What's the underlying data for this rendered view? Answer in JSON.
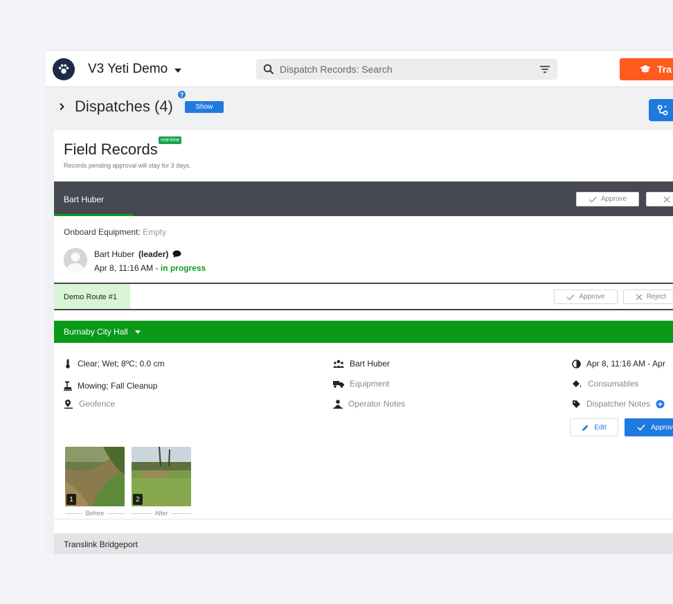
{
  "header": {
    "app_title": "V3 Yeti Demo",
    "search_placeholder": "Dispatch Records: Search",
    "training_label": "Tra"
  },
  "dispatches": {
    "title": "Dispatches (4)",
    "help_icon": "?",
    "show_label": "Show"
  },
  "field_records": {
    "title": "Field Records",
    "badge": "real-time",
    "subtitle": "Records pending approval will stay for 3 days.",
    "operator": {
      "name": "Bart Huber",
      "approve_label": "Approve"
    },
    "onboard_label": "Onboard Equipment:",
    "onboard_value": "Empty",
    "person": {
      "name": "Bart Huber",
      "role": "(leader)",
      "time": "Apr 8, 11:16 AM - ",
      "status": "in progress"
    },
    "route": {
      "name": "Demo Route #1",
      "approve_label": "Approve",
      "reject_label": "Reject"
    },
    "site": {
      "name": "Burnaby City Hall",
      "weather": "Clear; Wet; 8ºC; 0.0 cm",
      "services": "Mowing; Fall Cleanup",
      "geofence": "Geofence",
      "crew": "Bart Huber",
      "equipment": "Equipment",
      "operator_notes": "Operator Notes",
      "time_range": "Apr 8, 11:16 AM - Apr",
      "consumables": "Consumables",
      "dispatcher_notes": "Dispatcher Notes",
      "edit_label": "Edit",
      "approve_label": "Approv",
      "photos": [
        {
          "num": "1",
          "caption": "Before"
        },
        {
          "num": "2",
          "caption": "After"
        }
      ]
    },
    "next_site": "Translink Bridgeport"
  },
  "colors": {
    "brand_orange": "#ff5a1f",
    "primary_blue": "#1f7ae0",
    "success_green": "#0a9a17",
    "operator_bar": "#474952"
  }
}
